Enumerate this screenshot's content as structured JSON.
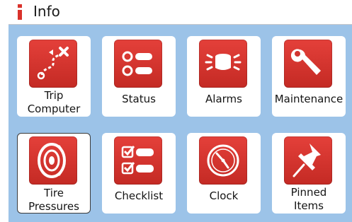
{
  "header": {
    "title": "Info",
    "icon": "info-icon",
    "accent_color": "#d9322b"
  },
  "grid": {
    "background_color": "#9cc3e8",
    "tiles": [
      {
        "label": "Trip\nComputer",
        "icon": "route-icon",
        "selected": false
      },
      {
        "label": "Status",
        "icon": "status-list-icon",
        "selected": false
      },
      {
        "label": "Alarms",
        "icon": "alarm-bell-icon",
        "selected": false
      },
      {
        "label": "Maintenance",
        "icon": "wrench-icon",
        "selected": false
      },
      {
        "label": "Tire\nPressures",
        "icon": "tire-icon",
        "selected": true
      },
      {
        "label": "Checklist",
        "icon": "checklist-icon",
        "selected": false
      },
      {
        "label": "Clock",
        "icon": "clock-icon",
        "selected": false
      },
      {
        "label": "Pinned\nItems",
        "icon": "pushpin-icon",
        "selected": false
      }
    ]
  }
}
